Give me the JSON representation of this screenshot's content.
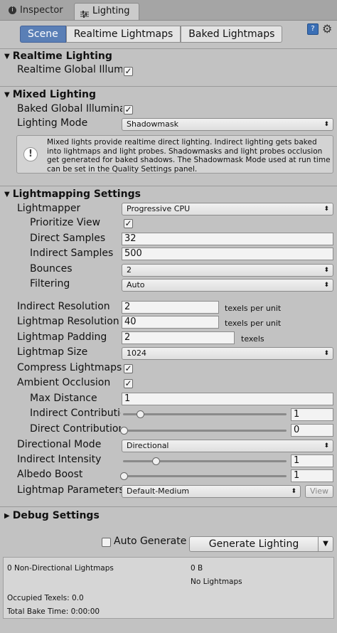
{
  "tabs": {
    "inspector": "Inspector",
    "lighting": "Lighting"
  },
  "mode_tabs": {
    "scene": "Scene",
    "realtime_lightmaps": "Realtime Lightmaps",
    "baked_lightmaps": "Baked Lightmaps"
  },
  "realtime": {
    "header": "Realtime Lighting",
    "global_illum_label": "Realtime Global Illumi",
    "global_illum_checked": true
  },
  "mixed": {
    "header": "Mixed Lighting",
    "baked_gi_label": "Baked Global Illumina",
    "baked_gi_checked": true,
    "lighting_mode_label": "Lighting Mode",
    "lighting_mode_value": "Shadowmask",
    "info_text": "Mixed lights provide realtime direct lighting. Indirect lighting gets baked into lightmaps and light probes. Shadowmasks and light probes occlusion get generated for baked shadows. The Shadowmask Mode used at run time can be set in the Quality Settings panel."
  },
  "lightmapping": {
    "header": "Lightmapping Settings",
    "lightmapper_label": "Lightmapper",
    "lightmapper_value": "Progressive CPU",
    "prioritize_view_label": "Prioritize View",
    "prioritize_view_checked": true,
    "direct_samples_label": "Direct Samples",
    "direct_samples_value": "32",
    "indirect_samples_label": "Indirect Samples",
    "indirect_samples_value": "500",
    "bounces_label": "Bounces",
    "bounces_value": "2",
    "filtering_label": "Filtering",
    "filtering_value": "Auto",
    "indirect_resolution_label": "Indirect Resolution",
    "indirect_resolution_value": "2",
    "indirect_resolution_unit": "texels per unit",
    "lightmap_resolution_label": "Lightmap Resolution",
    "lightmap_resolution_value": "40",
    "lightmap_resolution_unit": "texels per unit",
    "lightmap_padding_label": "Lightmap Padding",
    "lightmap_padding_value": "2",
    "lightmap_padding_unit": "texels",
    "lightmap_size_label": "Lightmap Size",
    "lightmap_size_value": "1024",
    "compress_label": "Compress Lightmaps",
    "compress_checked": true,
    "ambient_occlusion_label": "Ambient Occlusion",
    "ambient_occlusion_checked": true,
    "max_distance_label": "Max Distance",
    "max_distance_value": "1",
    "indirect_contribution_label": "Indirect Contributio",
    "indirect_contribution_value": "1",
    "direct_contribution_label": "Direct Contribution",
    "direct_contribution_value": "0",
    "directional_mode_label": "Directional Mode",
    "directional_mode_value": "Directional",
    "indirect_intensity_label": "Indirect Intensity",
    "indirect_intensity_value": "1",
    "albedo_boost_label": "Albedo Boost",
    "albedo_boost_value": "1",
    "lightmap_params_label": "Lightmap Parameters",
    "lightmap_params_value": "Default-Medium",
    "view_button": "View"
  },
  "debug": {
    "header": "Debug Settings"
  },
  "bottom": {
    "auto_generate_label": "Auto Generate",
    "auto_generate_checked": false,
    "generate_button": "Generate Lighting"
  },
  "stats": {
    "non_directional": "0 Non-Directional Lightmaps",
    "size": "0 B",
    "no_lightmaps": "No Lightmaps",
    "occupied_texels": "Occupied Texels: 0.0",
    "total_bake_time": "Total Bake Time: 0:00:00"
  },
  "icons": {
    "inspector_tab_icon": "info-icon",
    "lighting_tab_icon": "sliders-icon",
    "help": "book-icon",
    "settings": "gear-icon",
    "info_box": "exclamation-icon"
  }
}
